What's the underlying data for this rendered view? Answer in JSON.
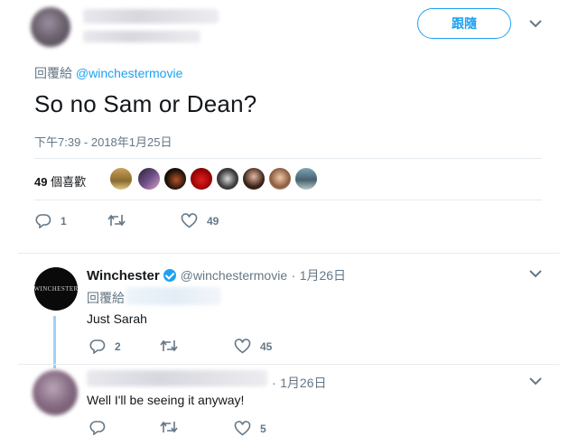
{
  "header": {
    "follow_label": "跟隨"
  },
  "tweet": {
    "reply_prefix": "回覆給",
    "reply_handle": "@winchestermovie",
    "text": "So no Sam or Dean?",
    "timestamp": "下午7:39 - 2018年1月25日",
    "likes_count": "49",
    "likes_label": "個喜歡",
    "actions": {
      "replies": "1",
      "retweets": "",
      "likes": "49"
    }
  },
  "reply1": {
    "avatar_text": "WINCHESTER",
    "name": "Winchester",
    "handle": "@winchestermovie",
    "sep": "·",
    "date": "1月26日",
    "reply_prefix": "回覆給",
    "text": "Just Sarah",
    "actions": {
      "replies": "2",
      "retweets": "",
      "likes": "45"
    }
  },
  "reply2": {
    "sep": "·",
    "date": "1月26日",
    "text": "Well I'll be seeing it anyway!",
    "actions": {
      "replies": "",
      "retweets": "",
      "likes": "5"
    }
  },
  "colors": {
    "accent": "#1da1f2",
    "muted": "#657786",
    "thread_line": "#9ed1f5"
  }
}
